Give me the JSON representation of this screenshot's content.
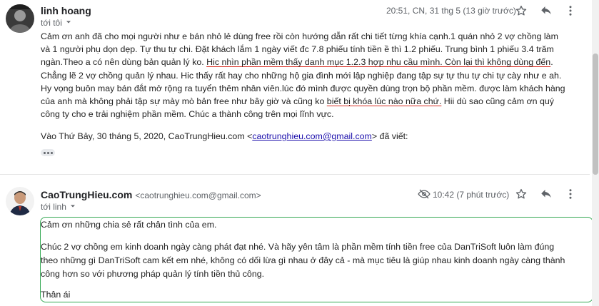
{
  "message1": {
    "sender": "linh hoang",
    "to_label": "tới tôi",
    "time": "20:51, CN, 31 thg 5 (13 giờ trước)",
    "icons": [
      "star-icon",
      "reply-icon",
      "more-vert-icon",
      "chevron-down-icon"
    ],
    "body": {
      "p1_a": "Cảm ơn anh đã cho mọi người như e bán nhỏ lẻ dùng free rồi còn hướng dẫn rất chi tiết từng khía cạnh.1 quán nhỏ 2 vợ chồng làm và 1 người phụ dọn dẹp. Tự thu tự chi. Đặt khách lắm 1 ngày viết đc 7.8 phiếu tính tiền ề thì 1.2 phiếu. Trung bình 1 phiếu 3.4 trăm ngàn.Theo a có nên dùng bản quản lý ko. ",
      "p1_underline": "Hic nhìn phần mềm thấy danh mục 1.2.3 hợp nhu cầu mình. Còn lại thì không dùng đến",
      "p1_b": ". Chẳng lẽ 2 vợ chồng quản lý nhau. Hic thấy rất hay cho những hộ gia đình mới lập nghiệp đang tập sự tự thu tự chi tự cày như e ah. Hy vọng buôn may bán đắt mở rộng ra tuyển thêm nhân viên.lúc đó mình được quyền dùng trọn bộ phần mềm. được làm khách hàng của anh mà không phải tập sự mày mò bản free như bây giờ và cũng ko ",
      "p1_underline2": "biết bị khóa lúc nào nữa chứ.",
      "p1_c": " Hii dù sao cũng cảm ơn quý công ty cho e trải nghiệm phần mềm. Chúc a thành công trên mọi lĩnh vực.",
      "quote_prefix": "Vào Thứ Bảy, 30 tháng 5, 2020, CaoTrungHieu.com <",
      "quote_email": "caotrunghieu.com@gmail.com",
      "quote_suffix": "> đã viết:"
    }
  },
  "message2": {
    "sender": "CaoTrungHieu.com",
    "sender_email": "<caotrunghieu.com@gmail.com>",
    "to_label": "tới linh",
    "time": "10:42 (7 phút trước)",
    "icons": [
      "snooze-icon",
      "star-icon",
      "reply-icon",
      "more-vert-icon",
      "chevron-down-icon"
    ],
    "body": {
      "line1": "Cảm ơn những chia sẻ rất chân tình của em.",
      "para2": "Chúc 2 vợ chồng em kinh doanh ngày càng phát đạt nhé. Và hãy yên tâm là phần mềm tính tiền free của DanTriSoft luôn làm đúng theo những gì DanTriSoft cam kết em nhé, không có dối lừa gì nhau ở đây cả - mà mục tiêu là giúp nhau kinh doanh ngày càng thành công hơn so với phương pháp quản lý tính tiền thủ công.",
      "signoff": "Thân ái"
    }
  },
  "colors": {
    "highlight_border": "#34a853",
    "underline": "#d93025",
    "link": "#1a0dab"
  }
}
